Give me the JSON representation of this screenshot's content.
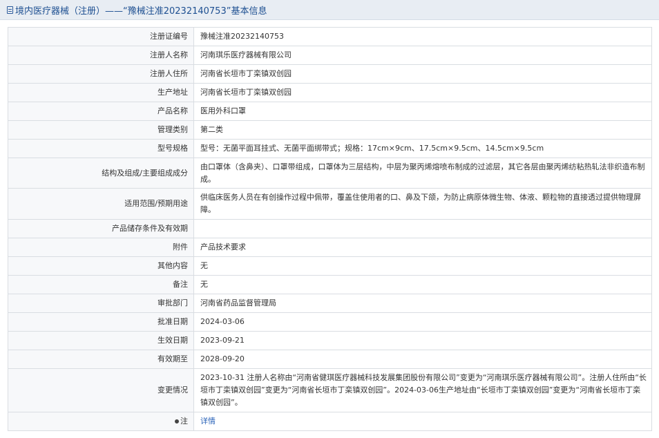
{
  "header": {
    "title": "境内医疗器械（注册）——“豫械注准20232140753”基本信息"
  },
  "rows": [
    {
      "label": "注册证编号",
      "value": "豫械注准20232140753"
    },
    {
      "label": "注册人名称",
      "value": "河南琪乐医疗器械有限公司"
    },
    {
      "label": "注册人住所",
      "value": "河南省长垣市丁栾镇双创园"
    },
    {
      "label": "生产地址",
      "value": "河南省长垣市丁栾镇双创园"
    },
    {
      "label": "产品名称",
      "value": "医用外科口罩"
    },
    {
      "label": "管理类别",
      "value": "第二类"
    },
    {
      "label": "型号规格",
      "value": "型号：无菌平面耳挂式、无菌平面绑带式；规格：17cm×9cm、17.5cm×9.5cm、14.5cm×9.5cm"
    },
    {
      "label": "结构及组成/主要组成成分",
      "value": "由口罩体（含鼻夹）、口罩带组成，口罩体为三层结构，中层为聚丙烯熔喷布制成的过滤层，其它各层由聚丙烯纺粘热轧法非织造布制成。"
    },
    {
      "label": "适用范围/预期用途",
      "value": "供临床医务人员在有创操作过程中佩带，覆盖住使用者的口、鼻及下颌，为防止病原体微生物、体液、颗粒物的直接透过提供物理屏障。"
    },
    {
      "label": "产品储存条件及有效期",
      "value": ""
    },
    {
      "label": "附件",
      "value": "产品技术要求"
    },
    {
      "label": "其他内容",
      "value": "无"
    },
    {
      "label": "备注",
      "value": "无"
    },
    {
      "label": "审批部门",
      "value": "河南省药品监督管理局"
    },
    {
      "label": "批准日期",
      "value": "2024-03-06"
    },
    {
      "label": "生效日期",
      "value": "2023-09-21"
    },
    {
      "label": "有效期至",
      "value": "2028-09-20"
    },
    {
      "label": "变更情况",
      "value": "2023-10-31 注册人名称由“河南省健琪医疗器械科技发展集团股份有限公司”变更为“河南琪乐医疗器械有限公司”。注册人住所由“长垣市丁栾镇双创园”变更为“河南省长垣市丁栾镇双创园”。2024-03-06生产地址由“长垣市丁栾镇双创园”变更为“河南省长垣市丁栾镇双创园”。"
    }
  ],
  "note": {
    "label": "注",
    "link_text": "详情"
  }
}
